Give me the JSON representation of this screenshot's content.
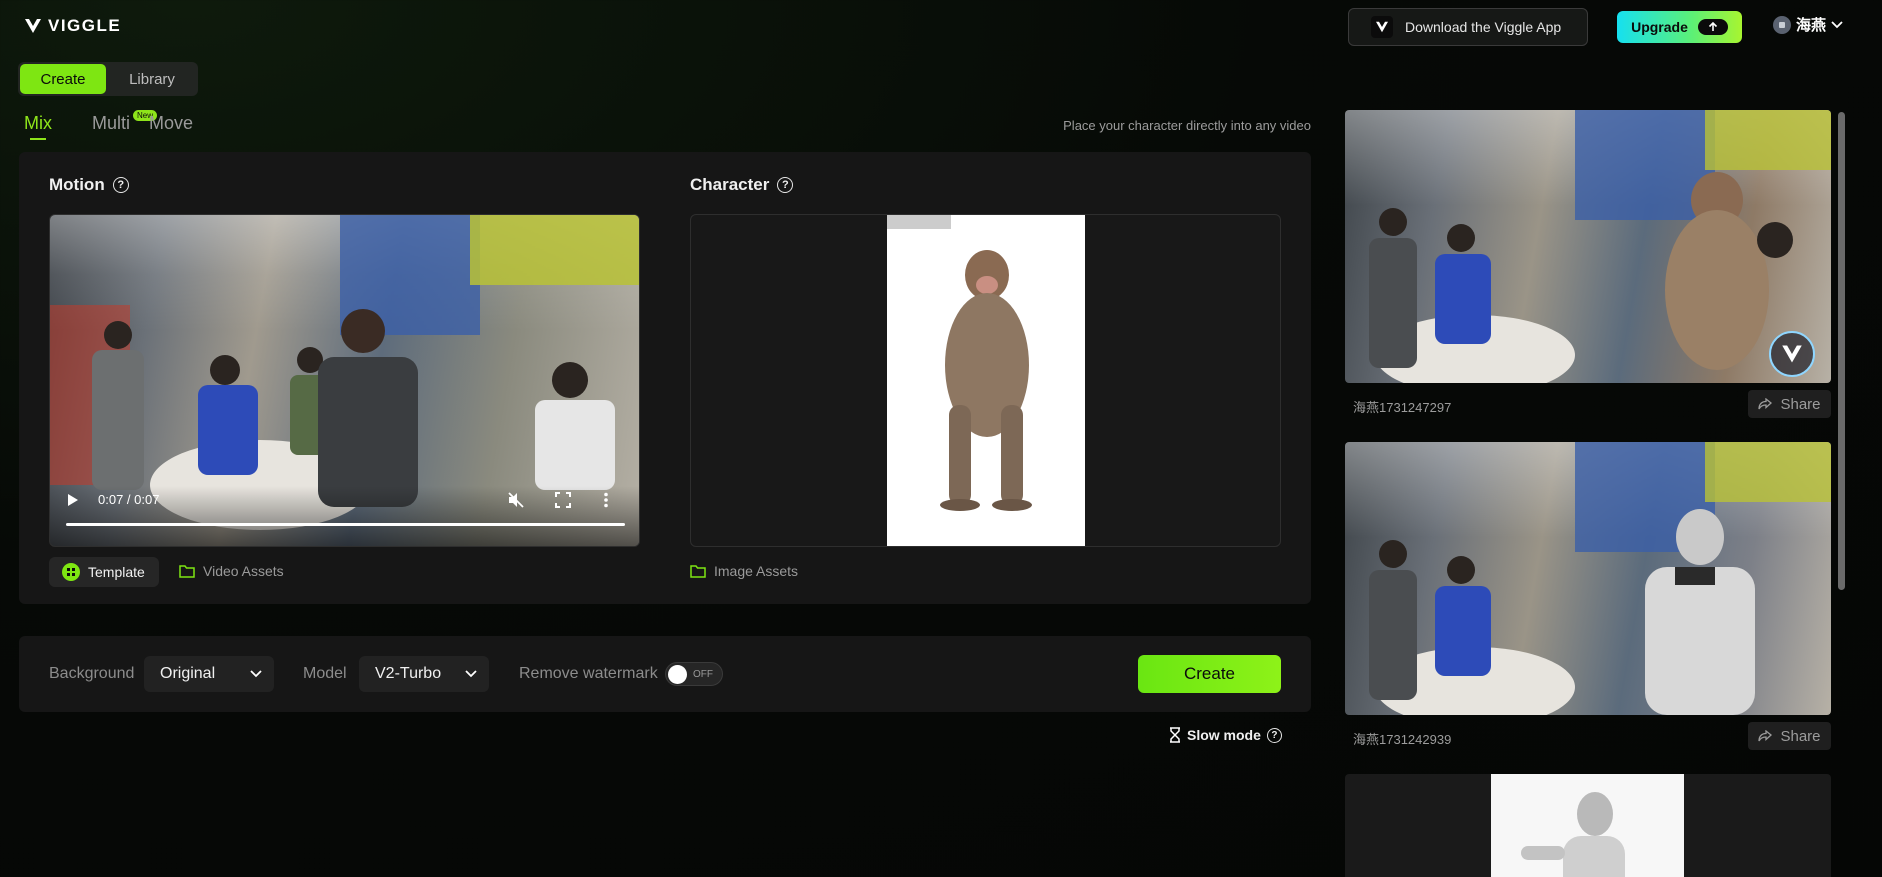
{
  "header": {
    "brand": "VIGGLE",
    "app_button": "Download the Viggle App",
    "upgrade_button": "Upgrade",
    "user_name": "海燕"
  },
  "mode_toggle": {
    "create": "Create",
    "library": "Library"
  },
  "subtabs": {
    "mix": "Mix",
    "multi": "Multi",
    "multi_badge": "New",
    "move": "Move"
  },
  "hint": "Place your character directly into any video",
  "motion": {
    "title": "Motion",
    "help": "?",
    "video_time": "0:07 / 0:07",
    "template_button": "Template",
    "assets_link": "Video Assets"
  },
  "character": {
    "title": "Character",
    "help": "?",
    "assets_link": "Image Assets"
  },
  "settings": {
    "background_label": "Background",
    "background_value": "Original",
    "model_label": "Model",
    "model_value": "V2-Turbo",
    "watermark_label": "Remove watermark",
    "watermark_state": "OFF",
    "create_button": "Create",
    "slow_mode": "Slow mode",
    "slow_help": "?"
  },
  "gallery": {
    "items": [
      {
        "name": "海燕1731247297",
        "share": "Share"
      },
      {
        "name": "海燕1731242939",
        "share": "Share"
      }
    ]
  },
  "colors": {
    "accent": "#7ee612",
    "panel": "#161616",
    "background": "#060906"
  }
}
